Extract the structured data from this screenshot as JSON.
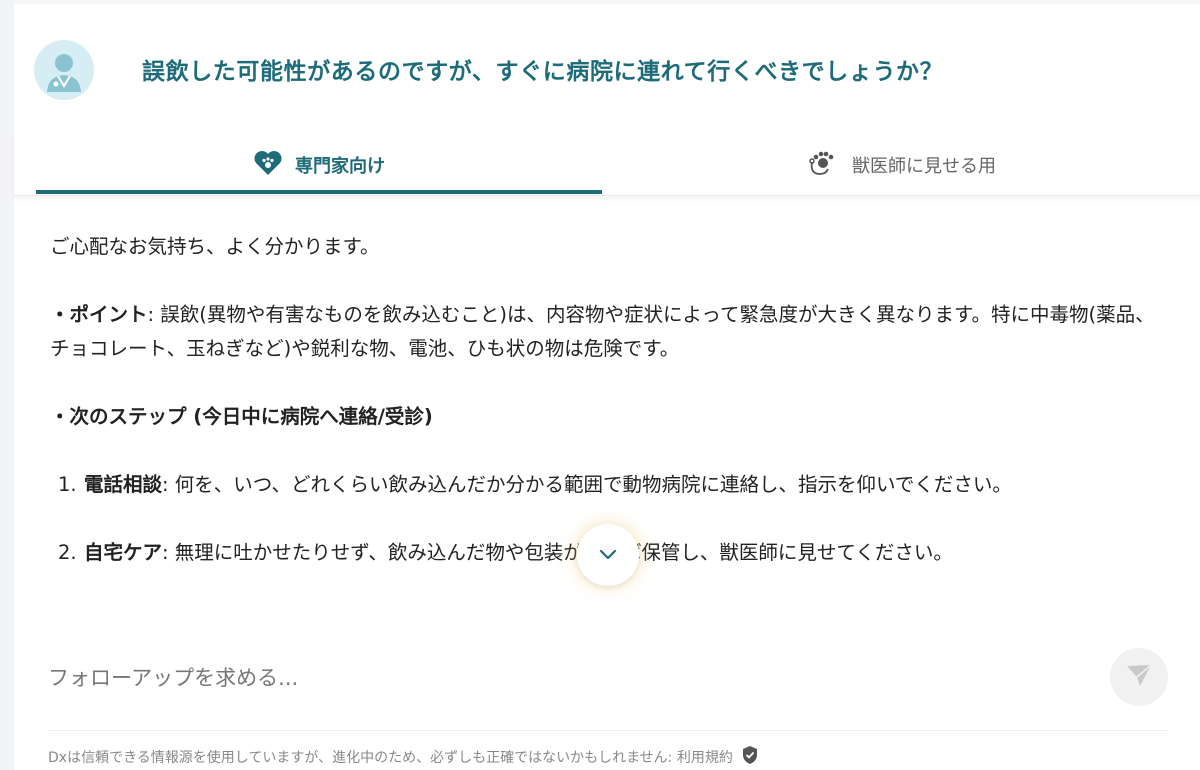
{
  "header": {
    "question": "誤飲した可能性があるのですが、すぐに病院に連れて行くべきでしょうか？",
    "avatar_icon": "vet-avatar-icon"
  },
  "tabs": [
    {
      "label": "専門家向け",
      "icon": "heart-paw-icon",
      "active": true
    },
    {
      "label": "獣医師に見せる用",
      "icon": "paw-stethoscope-icon",
      "active": false
    }
  ],
  "answer": {
    "intro": "ご心配なお気持ち、よく分かります。",
    "point_heading": "・ポイント",
    "point_text": ": 誤飲(異物や有害なものを飲み込むこと)は、内容物や症状によって緊急度が大きく異なります。特に中毒物(薬品、チョコレート、玉ねぎなど)や鋭利な物、電池、ひも状の物は危険です。",
    "next_heading": "・次のステップ (今日中に病院へ連絡/受診)",
    "steps": [
      {
        "num": "1.",
        "title": "電話相談",
        "text": ": 何を、いつ、どれくらい飲み込んだか分かる範囲で動物病院に連絡し、指示を仰いでください。"
      },
      {
        "num": "2.",
        "title": "自宅ケア",
        "text": ": 無理に吐かせたりせず、飲み込んだ物や包装があれば保管し、獣医師に見せてください。"
      }
    ]
  },
  "followup": {
    "placeholder": "フォローアップを求める..."
  },
  "footer": {
    "disclaimer": "Dxは信頼できる情報源を使用していますが、進化中のため、必ずしも正確ではないかもしれません: 利用規約"
  },
  "colors": {
    "accent": "#1e6b7a",
    "muted": "#888888"
  }
}
